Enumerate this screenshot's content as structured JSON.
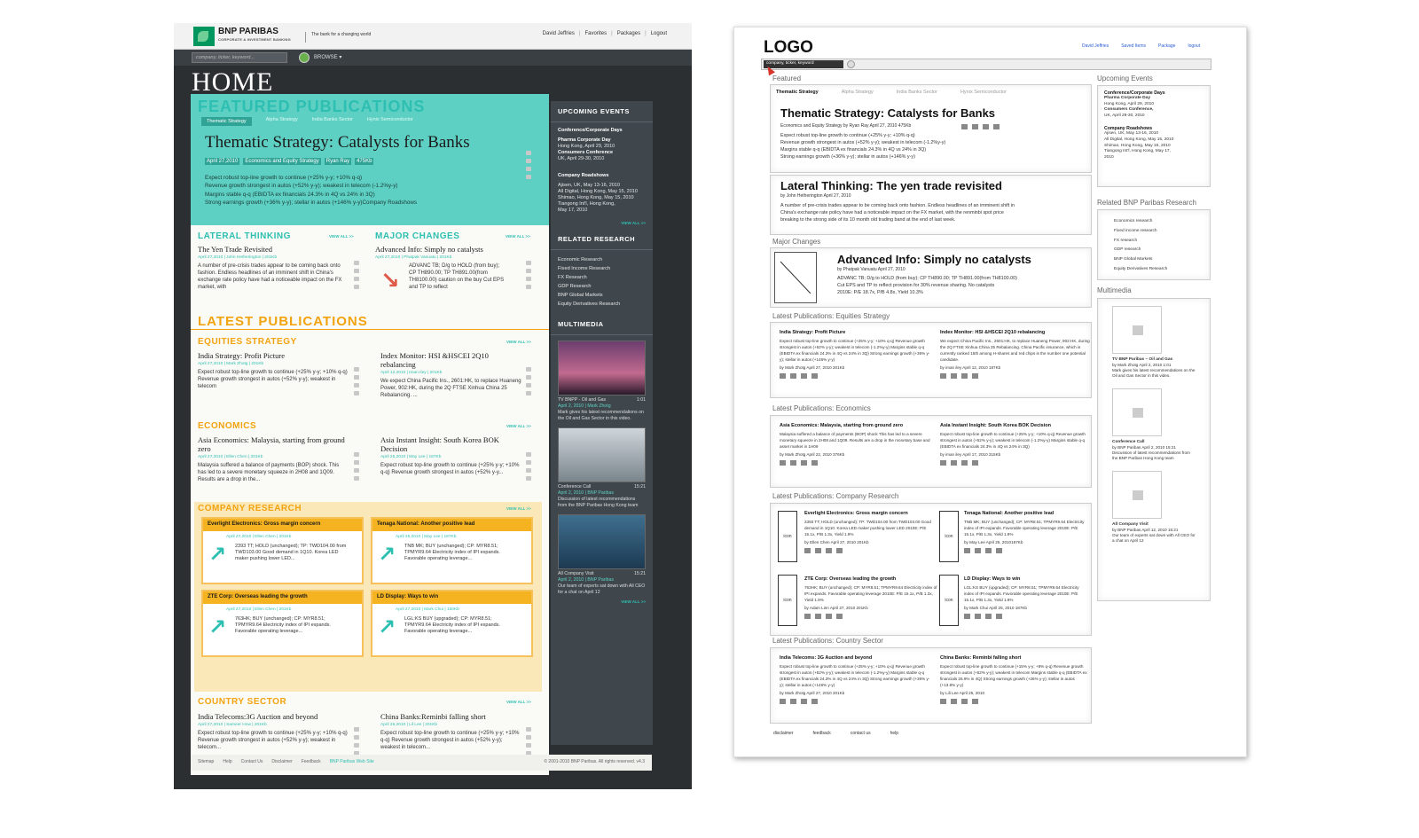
{
  "left": {
    "brand": {
      "name": "BNP PARIBAS",
      "sub": "CORPORATE & INVESTMENT BANKING",
      "tagline": "The bank for a changing world"
    },
    "top_links": [
      "David Jeffries",
      "Favorites",
      "Packages",
      "Logout"
    ],
    "search_placeholder": "company, ticker, keyword...",
    "browse": "BROWSE",
    "home": "HOME",
    "featured": {
      "heading": "FEATURED PUBLICATIONS",
      "tabs": [
        "Thematic Strategy",
        "Alpha Strategy",
        "India Banks Sector",
        "Hynix Semiconductor"
      ],
      "title": "Thematic Strategy: Catalysts for Banks",
      "meta": [
        "April 27,2010",
        "Economics and Equity Strategy",
        "Ryan Ray",
        "475Kb"
      ],
      "body": [
        "Expect robust top-line growth to continue (+25% y-y; +10% q-q)",
        "Revenue growth strongest in autos (+52% y-y); weakest in telecom (-1.2%y-y)",
        "Margins stable q-q (EBIDTA ex financials 24.3% in 4Q vs 24% in 3Q)",
        "Strong earnings growth (+36% y-y); stellar in autos (+146% y-y)Company Roadshows"
      ]
    },
    "lateral": {
      "heading": "LATERAL THINKING",
      "view_all": "VIEW ALL >>",
      "title": "The Yen Trade Revisited",
      "meta": "April 27,2010 | John Hetherington | 201Kb",
      "body": "A number of pre-crisis trades appear to be coming back onto fashion. Endless headlines of an imminent shift in China's exchange rate policy have had a noticeable impact on the FX market, with"
    },
    "major": {
      "heading": "MAJOR CHANGES",
      "view_all": "VIEW ALL >>",
      "title": "Advanced Info: Simply no catalysts",
      "meta": "April 27,2010 | Phatpak Vanuatu | 201Kb",
      "body": "ADVANC TB; D/g to HOLD (from buy); CP TH890.00; TP TH891.00(from TH8100.00) caution on the buy Cut EPS and TP to reflect"
    },
    "latest": {
      "heading": "LATEST PUBLICATIONS"
    },
    "equities": {
      "heading": "EQUITIES STRATEGY",
      "view_all": "VIEW ALL >>",
      "a1": {
        "title": "India Strategy: Profit Picture",
        "meta": "April 27,2010 | Mark Zhotg | 201Kb",
        "body": "Expect robust top-line growth to continue (+25% y-y; +10% q-q) Revenue growth strongest in autos (+52% y-y); weakest in telecom"
      },
      "a2": {
        "title": "Index Monitor: HSI &HSCEI 2Q10 rebalancing",
        "meta": "April 12,2010 | Iman Iley | 201Kb",
        "body": "We expect China Pacific Ins., 2601:HK, to replace Huaneng Power, 902:HK, during the 2Q FTSE Xinhua China 25 Rebalancing. ..."
      }
    },
    "economics": {
      "heading": "ECONOMICS",
      "view_all": "VIEW ALL >>",
      "a1": {
        "title": "Asia Economics: Malaysia, starting from ground zero",
        "meta": "April 27,2010 | Ellen Chen | 201Kb",
        "body": "Malaysia suffered a balance of payments (BOP) shock. This has led to a severe monetary squeeze in 2H08 and 1Q09. Results are a drop in the..."
      },
      "a2": {
        "title": "Asia Instant Insight: South Korea BOK Decision",
        "meta": "April 25,2010 | May Lee | 187Kb",
        "body": "Expect robust top-line growth to continue (+25% y-y; +10% q-q) Revenue growth strongest in autos (+52% y-y..."
      }
    },
    "company": {
      "heading": "COMPANY RESEARCH",
      "view_all": "VIEW ALL >>",
      "boxes": [
        {
          "head": "Everlight Electronics: Gross margin concern",
          "meta": "April 27,2010 | Ellen Chen | 201Kb",
          "body": "2393 TT; HOLD (unchanged); TP: TWD104.00 from TWD103.00 Good demand in 1Q10. Korea LED maker pushing lower LED..."
        },
        {
          "head": "Tenaga National: Another positive lead",
          "meta": "April 25,2010 | May Lee | 187Kb",
          "body": "TNB MK; BUY (unchanged); CP: MYR8.51; TPMYR9.64 Electricity index of IPI expands. Favorable operating leverage..."
        },
        {
          "head": "ZTE Corp: Overseas leading the growth",
          "meta": "April 27,2010 | Ellen Chen | 201Kb",
          "body": "763HK; BUY (unchanged); CP: MYR8.51; TPMYR9.64 Electricity index of IPI expands. Favorable operating leverage..."
        },
        {
          "head": "LD Display: Ways to win",
          "meta": "April 27,2010 | Mark Chui | 150Kb",
          "body": "LGL:KS BUY (upgraded); CP: MYR8.51; TPMYR9.64 Electricity index of IPI expands. Favorable operating leverage..."
        }
      ]
    },
    "country": {
      "heading": "COUNTRY SECTOR",
      "view_all": "VIEW ALL >>",
      "a1": {
        "title": "India Telecoms:3G Auction and beyond",
        "meta": "April 27,2010 | Sameer How | 201Kb",
        "body": "Expect robust top-line growth to continue (+25% y-y; +10% q-q) Revenue growth strongest in autos (+52% y-y); weakest in telecom..."
      },
      "a2": {
        "title": "China Banks:Reminbi falling short",
        "meta": "April 25,2010 | Lil Lee | 201Kb",
        "body": "Expect robust top-line growth to continue (+25% y-y; +10% q-q) Revenue growth strongest in autos (+52% y-y); weakest in telecom..."
      }
    },
    "sidebar": {
      "events_head": "UPCOMING EVENTS",
      "events_title": "Conference/Corporate Days",
      "events": [
        "Pharma Corporate Day",
        "Hong Kong, April 29, 2010",
        "Consumers Conference",
        "UK, April 29-30, 2010"
      ],
      "roadshows_title": "Company Roadshows",
      "roadshows": [
        "Ajisen, UK, May 13-16, 2010",
        "All Digital, Hong Kong, May 15, 2010",
        "Shimao, Hong Kong, May 15, 2010",
        "Tiangong Int'l, Hong Kong,",
        "May 17, 2010"
      ],
      "view_all": "VIEW ALL >>",
      "research_head": "RELATED RESEARCH",
      "research": [
        "Economic Research",
        "Fixed Income Research",
        "FX Research",
        "GDP Research",
        "BNP Global Markets",
        "Equity Derivatives Research"
      ],
      "multimedia_head": "MULTIMEDIA",
      "media": [
        {
          "title": "TV BNPP - Oil and Gas",
          "time": "1:01",
          "meta": "April 2, 2010 | Mark Zhotg",
          "desc": "Mark gives his latest recommendations on the Oil and Gas Sector in this video."
        },
        {
          "title": "Conference Call",
          "time": "15:21",
          "meta": "April 2, 2010 | BNP Paribas",
          "desc": "Discussion of latest recommendations from the BNP Paribas Hong Kong team"
        },
        {
          "title": "All Company Visit",
          "time": "15:21",
          "meta": "April 2, 2010 | BNP Paribas",
          "desc": "Our team of experts sat down with All CEO for a chat on April 12"
        }
      ]
    },
    "footer": [
      "Sitemap",
      "Help",
      "Contact Us",
      "Disclaimer",
      "Feedback",
      "BNP Paribas Web Site"
    ],
    "copyright": "© 2001-2010 BNP Paribas. All rights reserved. v4.3"
  },
  "right": {
    "logo": "LOGO",
    "links": [
      "David Jeffries",
      "Saved Items",
      "Package",
      "logout"
    ],
    "search": "company, ticker, keyword",
    "featured_label": "Featured",
    "tabs": [
      "Thematic Strategy",
      "Alpha Strategy",
      "India Banks Sector",
      "Hynix Semiconductor"
    ],
    "f1": {
      "title": "Thematic Strategy: Catalysts for Banks",
      "meta": "Economics and Equity Strategy   by Ryan Ray      April 27, 2010    475Kb",
      "body": [
        "Expect robust top-line growth to continue (+25% y-y; +10% q-q)",
        "Revenue growth strongest in autos (+52% y-y); weakest in telecom (-1.2%y-y)",
        "Margins stable q-q (EBIDTA ex financials 24.3% in 4Q vs 24% in 3Q)",
        "Strong earnings growth (+36% y-y); stellar in autos (+146% y-y)"
      ]
    },
    "f2": {
      "title": "Lateral Thinking: The yen trade revisited",
      "meta": "by John Hetherington   April 27, 2010",
      "body": [
        "A number of pre-crisis trades appear to be coming back onto fashion. Endless headlines of an imminent shift in",
        "China's exchange rate policy have had a noticeable impact on the FX market, with the renminbi spot price",
        "breaking to the strong side of its 10 month old trading band at the end of last week."
      ]
    },
    "major_label": "Major Changes",
    "major": {
      "title": "Advanced Info: Simply no catalysts",
      "meta": "by Phatpak Vanuatu    April 27, 2010",
      "body": [
        "ADVANC TB; D/g to HOLD (from buy); CP TH890.00; TP TH891.00(from TH8100.00)",
        "Cut EPS and TP to reflect provision for 30% revenue sharing. No catalysts",
        "2010E: P/E 18.7x, P/B 4.8x, Yield 10.3%"
      ]
    },
    "eq_label": "Latest Publications: Equities Strategy",
    "eq": [
      {
        "t": "India Strategy: Profit Picture",
        "b": "Expect robust top-line growth to continue (+25% y-y; +10% q-q) Revenue growth strongest in autos (+52% y-y); weakest in telecom (-1.2%y-y) Margins stable q-q (EBIDTA ex financials 24.3% in 4Q vs 24% in 3Q) Strong earnings growth (+36% y-y); stellar in autos (+146% y-y)",
        "m": "by Mark Zhotg     April 27, 2010     201Kb"
      },
      {
        "t": "Index Monitor: HSI &HSCEI 2Q10 rebalancing",
        "b": "We expect China Pacific Ins., 2601:HK, to replace Huaneng Power, 902:HK, during the 2Q FTSE Xinhua China 25 Rebalancing. China Pacific insurance, which is currently ranked 15th among H-shares and red chips is the number one potential candidate.",
        "m": "by iman iley        April 12, 2010     187Kb"
      }
    ],
    "ec_label": "Latest Publications: Economics",
    "ec": [
      {
        "t": "Asia Economics: Malaysia, starting from ground zero",
        "b": "Malaysia suffered a balance of payments (BOP) shock This has led to a severe monetary squeeze in 2H08 and 1Q09. Results are a drop in the monetary base and asset market in 1H09",
        "m": "by Mark Zhotg     April 22, 2010     376Kb"
      },
      {
        "t": "Asia Instant Insight: South Korea BOK Decision",
        "b": "Expect robust top-line growth to continue (+25% y-y; +10% q-q) Revenue growth strongest in autos (+52% y-y); weakest in telecom (-1.2%y-y) Margins stable q-q (EBIDTA ex financials 24.3% in 4Q vs 24% in 3Q)",
        "m": "by iman iley        April 17, 2010     315Kb"
      }
    ],
    "cr_label": "Latest Publications: Company Research",
    "cr": [
      {
        "t": "Everlight Electronics: Gross margin concern",
        "b": "2393 TT; HOLD (unchanged); TP: TWD104.00 from TWD103.00 Good demand in 1Q10. Korea LED maker pushing lower LED 2010E: P/E 15.1x, P/B 1.3x, Yield 1.9%",
        "m": "by Ellen Chen        April 27, 2010     201Kb"
      },
      {
        "t": "Tenaga National: Another positive lead",
        "b": "TNB MK; BUY (unchanged); CP: MYR8.51; TPMYR9.64 Electricity index of IPI expands. Favorable operating leverage 2010E: P/E 15.1x, P/B 1.3x, Yield 1.9%",
        "m": "by May Lee        April 25, 2010187Kb"
      },
      {
        "t": "ZTE Corp: Overseas leading the growth",
        "b": "763HK; BUY (unchanged); CP: MYR8.51; TPMYR9.64 Electricity index of IPI expands. Favorable operating leverage 2010E: P/E 15.1x, P/B 1.3x, Yield 1.9%",
        "m": "by Adam Linn     April 27, 2010     201Kb"
      },
      {
        "t": "LD Display: Ways to win",
        "b": "LGL:KS BUY (upgraded); CP: MYR8.51; TPMYR9.64 Electricity index of IPI expands. Favorable operating leverage 2010E: P/E 15.1x, P/B 1.3x, Yield 1.9%",
        "m": "by Mark Chui       April 25, 2010     187Kb"
      }
    ],
    "icon_label": "icon",
    "cs_label": "Latest Publications: Country Sector",
    "cs": [
      {
        "t": "India Telecoms: 3G Auction and beyond",
        "b": "Expect robust top-line growth to continue (+25% y-y; +10% q-q) Revenue growth strongest in autos (+52% y-y); weakest in telecom (-1.2%y-y) Margins stable q-q (EBIDTA ex financials 24.3% in 4Q vs 24% in 3Q) Strong earnings growth (+36% y-y); stellar in autos (+146% y-y)",
        "m": "by Mark Zhotg     April 27, 2010     201Kb"
      },
      {
        "t": "China Banks: Reminbi falling short",
        "b": "Expect robust top-line growth to continue (+15% y-y; +8% q-q) Revenue growth strongest in autos (+52% y-y); weakest in telecom Margins stable q-q (EBIDTA ex financials 26.9% in 4Q) Strong earnings growth (+26% y-y); stellar in autos (+13.8% y-y)",
        "m": "by Lili Lee        April 25, 2010"
      }
    ],
    "events_label": "Upcoming Events",
    "events": [
      {
        "h": "Conference/Corporate Days",
        "s": [
          "Pharma Corporate Day",
          "Hong Kong, April 29, 2010",
          "Consumers Conference,",
          "UK, April 29-30, 2010"
        ]
      },
      {
        "h": "Company Roadshows",
        "s": [
          "Ajisen, UK, May 13-16, 2010",
          "All Digital, Hong Kong, May 15, 2010",
          "Shimao, Hong Kong, May 15, 2010",
          "Tiangong Int'l, Hong Kong, May 17,",
          "2010"
        ]
      }
    ],
    "research_label": "Related BNP Paribas Research",
    "research": [
      "Economics research",
      "Fixed income research",
      "FX research",
      "GDP research",
      "BNP Global Markets",
      "Equity Derivatives Research"
    ],
    "multimedia_label": "Multimedia",
    "media": [
      {
        "t": "TV BNP Paribas – Oil and Gas",
        "m": "by Mark Zhotg  April 2, 2010 1:01",
        "d": "Mark gives his latest recommendations on the Oil and Gas Sector in this video."
      },
      {
        "t": "Conference Call",
        "m": "by BNP Paribas  April 2, 2010 15:21",
        "d": "Discussion of latest recommendations from the BNP Paribas Hong Kong team"
      },
      {
        "t": "All Company Visit",
        "m": "by BNP Paribas  April 12, 2010 15:21",
        "d": "Our team of experts sat down with All CEO for a chat on April 12"
      }
    ],
    "footer": [
      "disclaimer",
      "feedback",
      "contact us",
      "help"
    ]
  }
}
